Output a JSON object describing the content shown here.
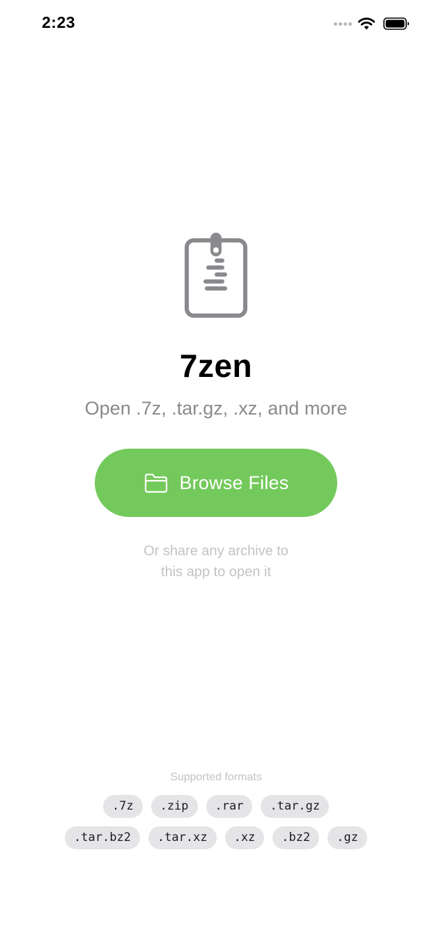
{
  "status_bar": {
    "time": "2:23",
    "icons": [
      "signal-dots-icon",
      "wifi-icon",
      "battery-icon"
    ]
  },
  "app": {
    "icon": "zip-archive-icon",
    "title": "7zen",
    "subtitle": "Open .7z, .tar.gz, .xz, and more"
  },
  "browse_button": {
    "icon": "folder-icon",
    "label": "Browse Files",
    "color": "#74c95c"
  },
  "share_hint": {
    "line1": "Or share any archive to",
    "line2": "this app to open it"
  },
  "supported_formats": {
    "label": "Supported formats",
    "row1": [
      ".7z",
      ".zip",
      ".rar",
      ".tar.gz"
    ],
    "row2": [
      ".tar.bz2",
      ".tar.xz",
      ".xz",
      ".bz2",
      ".gz"
    ]
  },
  "colors": {
    "accent": "#74c95c",
    "secondary_text": "#8a8a8e",
    "tertiary_text": "#c3c3c6",
    "chip_background": "#e5e5e7"
  }
}
